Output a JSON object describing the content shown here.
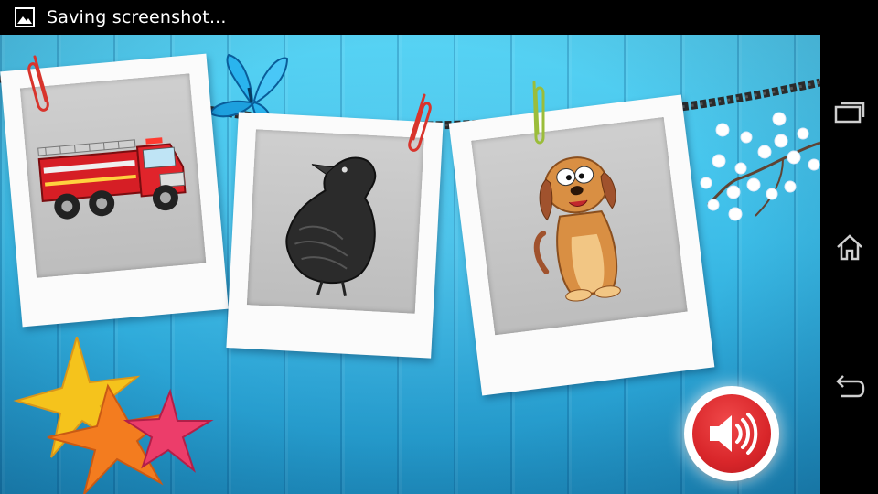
{
  "status_bar": {
    "icon": "picture-icon",
    "text": "Saving screenshot..."
  },
  "game": {
    "cards": [
      {
        "subject": "fire-truck"
      },
      {
        "subject": "crow"
      },
      {
        "subject": "dog"
      }
    ],
    "decorations": [
      "butterfly-icon",
      "blossom-branch-icon",
      "starfish-icon"
    ],
    "sound_button": {
      "icon": "speaker-icon",
      "color": "#d9262a"
    }
  },
  "nav_bar": {
    "buttons": [
      "recent-apps-icon",
      "home-icon",
      "back-icon"
    ]
  },
  "colors": {
    "background_top": "#57d3f4",
    "background_bottom": "#1f8fc0",
    "sound_red": "#d9262a"
  }
}
